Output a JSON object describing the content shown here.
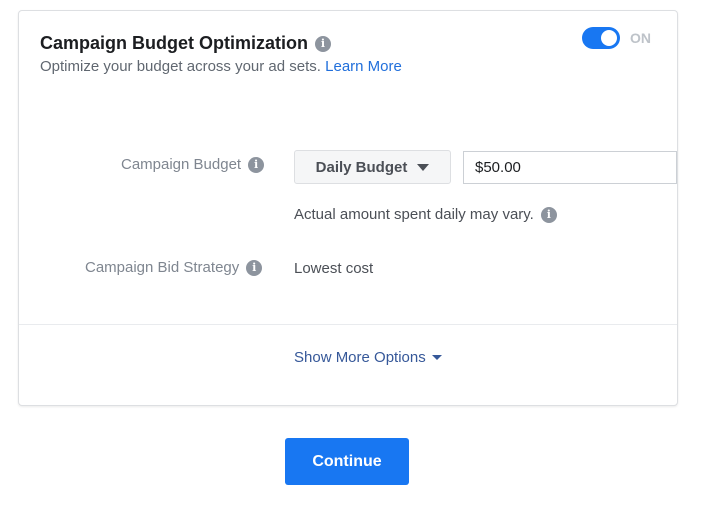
{
  "cbo": {
    "title": "Campaign Budget Optimization",
    "subtitle": "Optimize your budget across your ad sets.",
    "learn_more": "Learn More",
    "toggle_state": "ON",
    "info_glyph": "i"
  },
  "budget": {
    "label": "Campaign Budget",
    "type_selected": "Daily Budget",
    "amount_value": "$50.00",
    "note": "Actual amount spent daily may vary."
  },
  "bid_strategy": {
    "label": "Campaign Bid Strategy",
    "value": "Lowest cost"
  },
  "more_options": "Show More Options",
  "continue_label": "Continue",
  "colors": {
    "accent": "#1877f2",
    "link": "#216fdb",
    "more_link": "#365899"
  }
}
